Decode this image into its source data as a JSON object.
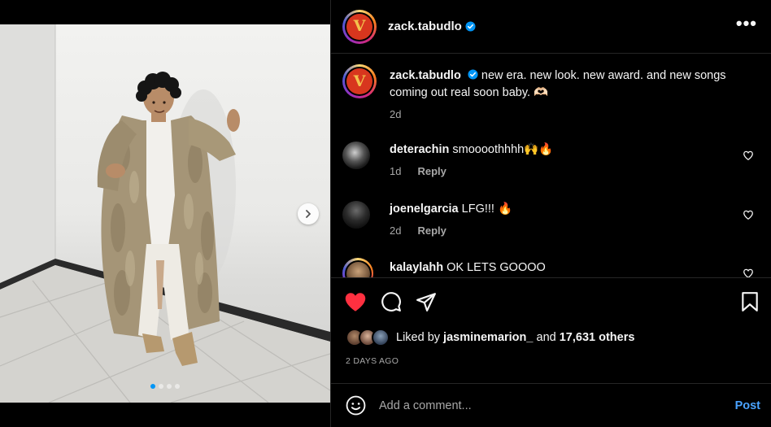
{
  "post": {
    "username": "zack.tabudlo",
    "avatar_letter": "V",
    "verified": true,
    "more_label": "•••",
    "carousel": {
      "slide_count": 4,
      "active_index": 0
    }
  },
  "caption": {
    "username": "zack.tabudlo",
    "text": "new era. new look. new award. and new songs coming out real soon baby. 🫶🏻",
    "time": "2d"
  },
  "comments": [
    {
      "username": "deterachin",
      "text": "smoooothhhh🙌🔥",
      "time": "1d",
      "reply_label": "Reply"
    },
    {
      "username": "joenelgarcia",
      "text": "LFG!!! 🔥",
      "time": "2d",
      "reply_label": "Reply"
    },
    {
      "username": "kalaylahh",
      "text": "OK LETS GOOOO",
      "time": "",
      "reply_label": ""
    }
  ],
  "likes": {
    "prefix": "Liked by",
    "top_liker": "jasminemarion_",
    "connector": "and",
    "others": "17,631 others",
    "liked_by_me": true
  },
  "time_ago": "2 DAYS AGO",
  "composer": {
    "placeholder": "Add a comment...",
    "post_label": "Post"
  },
  "colors": {
    "like_red": "#ff3040",
    "link_blue": "#4aa3ff",
    "verified_blue": "#0095f6",
    "avatar_red": "#d8361e"
  },
  "icons": {
    "like": "heart-filled-icon",
    "comment": "comment-bubble-icon",
    "share": "paper-plane-icon",
    "save": "bookmark-icon",
    "next": "chevron-right-icon",
    "emoji": "smiley-icon",
    "verified": "verified-badge-icon",
    "more": "more-options-icon"
  }
}
